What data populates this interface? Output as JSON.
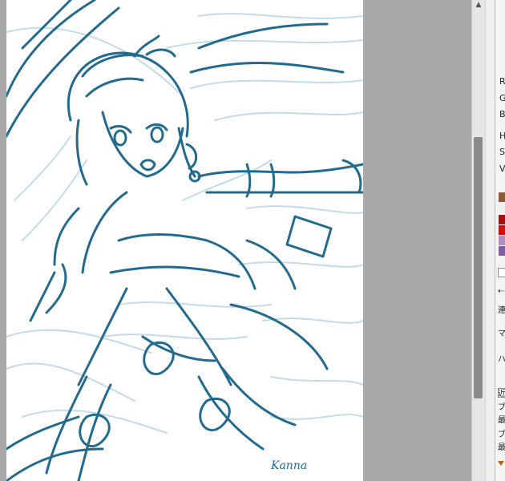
{
  "canvas": {
    "signature": "Kanna",
    "ink_color": "#236b8e",
    "light_color": "#bcd8e6"
  },
  "color_panel": {
    "labels": [
      "R",
      "G",
      "B",
      "H",
      "S",
      "V"
    ],
    "swatches": [
      "#8a5a3a",
      "#f0f0f0",
      "#a01010",
      "#d01010",
      "#b090c0",
      "#8060a0"
    ]
  },
  "side_panel": {
    "small_text": [
      "連",
      "マ",
      "ハ",
      "近",
      "ブ",
      "最",
      "ブ",
      "最"
    ]
  },
  "scrollbar": {
    "up_arrow": "▲"
  }
}
